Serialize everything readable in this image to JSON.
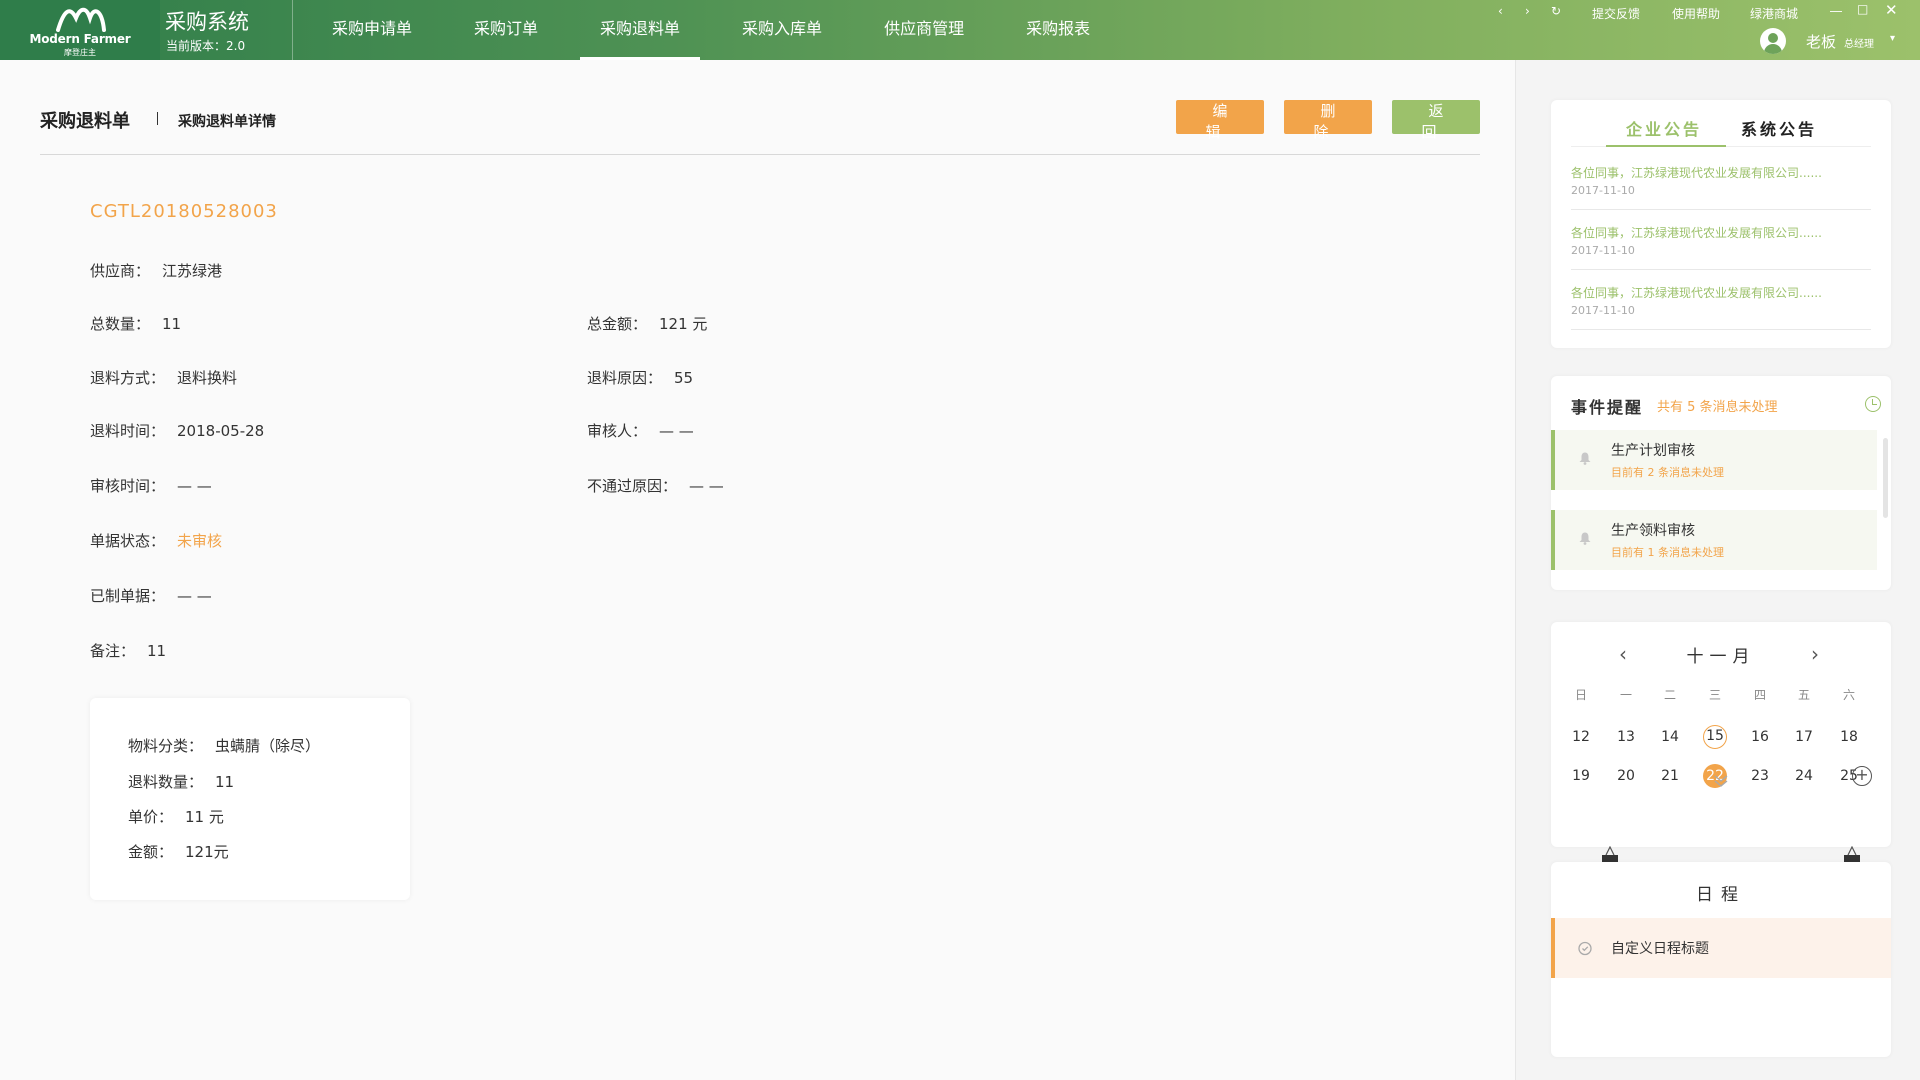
{
  "app": {
    "logo_en": "Modern Farmer",
    "logo_cn": "摩登庄主",
    "title": "采购系统",
    "version": "当前版本：2.0"
  },
  "nav": [
    "采购申请单",
    "采购订单",
    "采购退料单",
    "采购入库单",
    "供应商管理",
    "采购报表"
  ],
  "nav_active": "采购退料单",
  "top_links": {
    "feedback": "提交反馈",
    "help": "使用帮助",
    "mall": "绿港商城"
  },
  "window_controls": [
    "chevron-left-icon",
    "chevron-right-icon",
    "refresh-icon",
    "minimize-icon",
    "maximize-icon",
    "close-icon"
  ],
  "user": {
    "name": "老板",
    "role": "总经理"
  },
  "page": {
    "title": "采购退料单",
    "subtitle": "采购退料单详情",
    "buttons": {
      "edit": "编 辑",
      "delete": "删 除",
      "back": "返 回"
    },
    "order_no": "CGTL20180528003"
  },
  "fields": {
    "supplier": {
      "label": "供应商：",
      "value": "江苏绿港"
    },
    "total_qty": {
      "label": "总数量：",
      "value": "11"
    },
    "total_amount": {
      "label": "总金额：",
      "value": "121 元"
    },
    "return_method": {
      "label": "退料方式：",
      "value": "退料换料"
    },
    "return_reason": {
      "label": "退料原因：",
      "value": "55"
    },
    "return_time": {
      "label": "退料时间：",
      "value": "2018-05-28"
    },
    "reviewer": {
      "label": "审核人：",
      "value": "— —"
    },
    "review_time": {
      "label": "审核时间：",
      "value": "— —"
    },
    "reject_reason": {
      "label": "不通过原因：",
      "value": "— —"
    },
    "status": {
      "label": "单据状态：",
      "value": "未审核"
    },
    "made_docs": {
      "label": "已制单据：",
      "value": "— —"
    },
    "remark": {
      "label": "备注：",
      "value": "11"
    }
  },
  "item": {
    "category": {
      "label": "物料分类：",
      "value": "虫螨腈（除尽）"
    },
    "qty": {
      "label": "退料数量：",
      "value": "11"
    },
    "price": {
      "label": "单价：",
      "value": "11 元"
    },
    "amount": {
      "label": "金额：",
      "value": "121元"
    }
  },
  "notice": {
    "tabs": [
      "企业公告",
      "系统公告"
    ],
    "active_tab": "企业公告",
    "items": [
      {
        "text": "各位同事，江苏绿港现代农业发展有限公司......",
        "date": "2017-11-10"
      },
      {
        "text": "各位同事，江苏绿港现代农业发展有限公司......",
        "date": "2017-11-10"
      },
      {
        "text": "各位同事，江苏绿港现代农业发展有限公司......",
        "date": "2017-11-10"
      }
    ]
  },
  "events": {
    "title": "事件提醒",
    "summary": "共有 5 条消息未处理",
    "items": [
      {
        "name": "生产计划审核",
        "count": "目前有  2  条消息未处理"
      },
      {
        "name": "生产领料审核",
        "count": "目前有  1  条消息未处理"
      }
    ]
  },
  "calendar": {
    "month": "十一月",
    "weekdays": [
      "日",
      "一",
      "二",
      "三",
      "四",
      "五",
      "六"
    ],
    "rows": [
      [
        "12",
        "13",
        "14",
        "15",
        "16",
        "17",
        "18"
      ],
      [
        "19",
        "20",
        "21",
        "22",
        "23",
        "24",
        "25"
      ]
    ],
    "today": "15",
    "selected": "22"
  },
  "schedule": {
    "title": "日程",
    "items": [
      {
        "name": "自定义日程标题"
      }
    ]
  },
  "colors": {
    "accent_green": "#9cc16b",
    "accent_orange": "#f2a44a",
    "header_dark": "#2f7d4a"
  }
}
